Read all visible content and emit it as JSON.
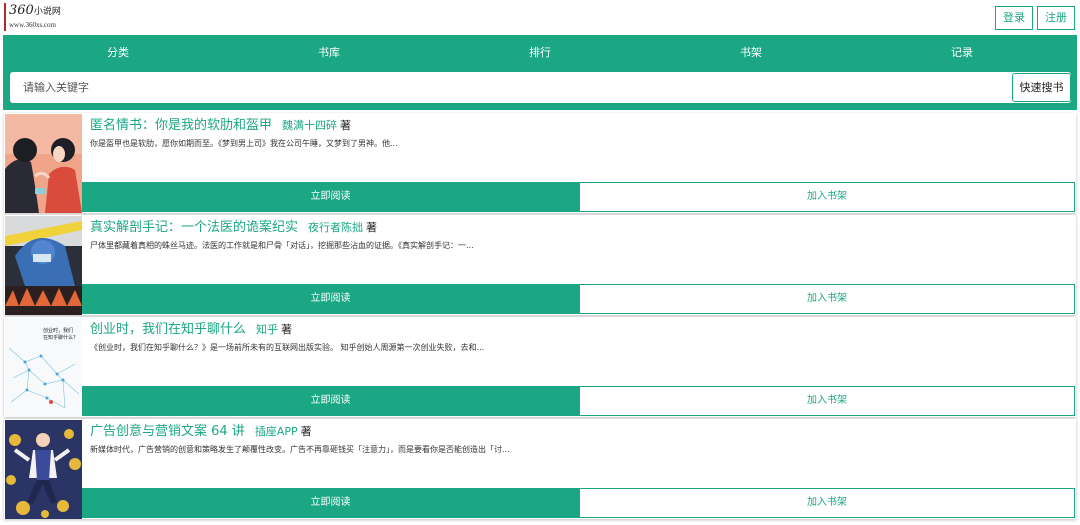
{
  "logo": {
    "brand": "360",
    "brand_cn": "小说网",
    "url": "www.360xs.com"
  },
  "auth": {
    "login": "登录",
    "register": "注册"
  },
  "nav": {
    "items": [
      "分类",
      "书库",
      "排行",
      "书架",
      "记录"
    ]
  },
  "search": {
    "placeholder": "请输入关键字",
    "button": "快速搜书"
  },
  "colors": {
    "accent": "#1ba784"
  },
  "books": [
    {
      "title": "匿名情书：你是我的软肋和盔甲",
      "author": "魏满十四碎",
      "zhu": "著",
      "desc": "你是盔甲也是软肋，愿你如期而至。《梦到男上司》我在公司午睡，又梦到了男神。他...",
      "read": "立即阅读",
      "shelf": "加入书架"
    },
    {
      "title": "真实解剖手记：一个法医的诡案纪实",
      "author": "夜行者陈拙",
      "zhu": "著",
      "desc": "尸体里都藏着真相的蛛丝马迹。法医的工作就是和尸骨「对话」，挖掘那些沾血的证据。《真实解剖手记：一...",
      "read": "立即阅读",
      "shelf": "加入书架"
    },
    {
      "title": "创业时，我们在知乎聊什么",
      "author": "知乎",
      "zhu": "著",
      "desc": "《创业时，我们在知乎聊什么？》是一场前所未有的互联网出版实验。 知乎创始人周源第一次创业失败，去和...",
      "read": "立即阅读",
      "shelf": "加入书架",
      "cover_text": [
        "创业时，我们",
        "在知乎聊什么？"
      ]
    },
    {
      "title": "广告创意与营销文案 64 讲",
      "author": "插座APP",
      "zhu": "著",
      "desc": "新媒体时代，广告营销的创意和策略发生了颠覆性改变。广告不再靠砸钱买「注意力」，而是要看你是否能创造出「讨...",
      "read": "立即阅读",
      "shelf": "加入书架"
    }
  ]
}
